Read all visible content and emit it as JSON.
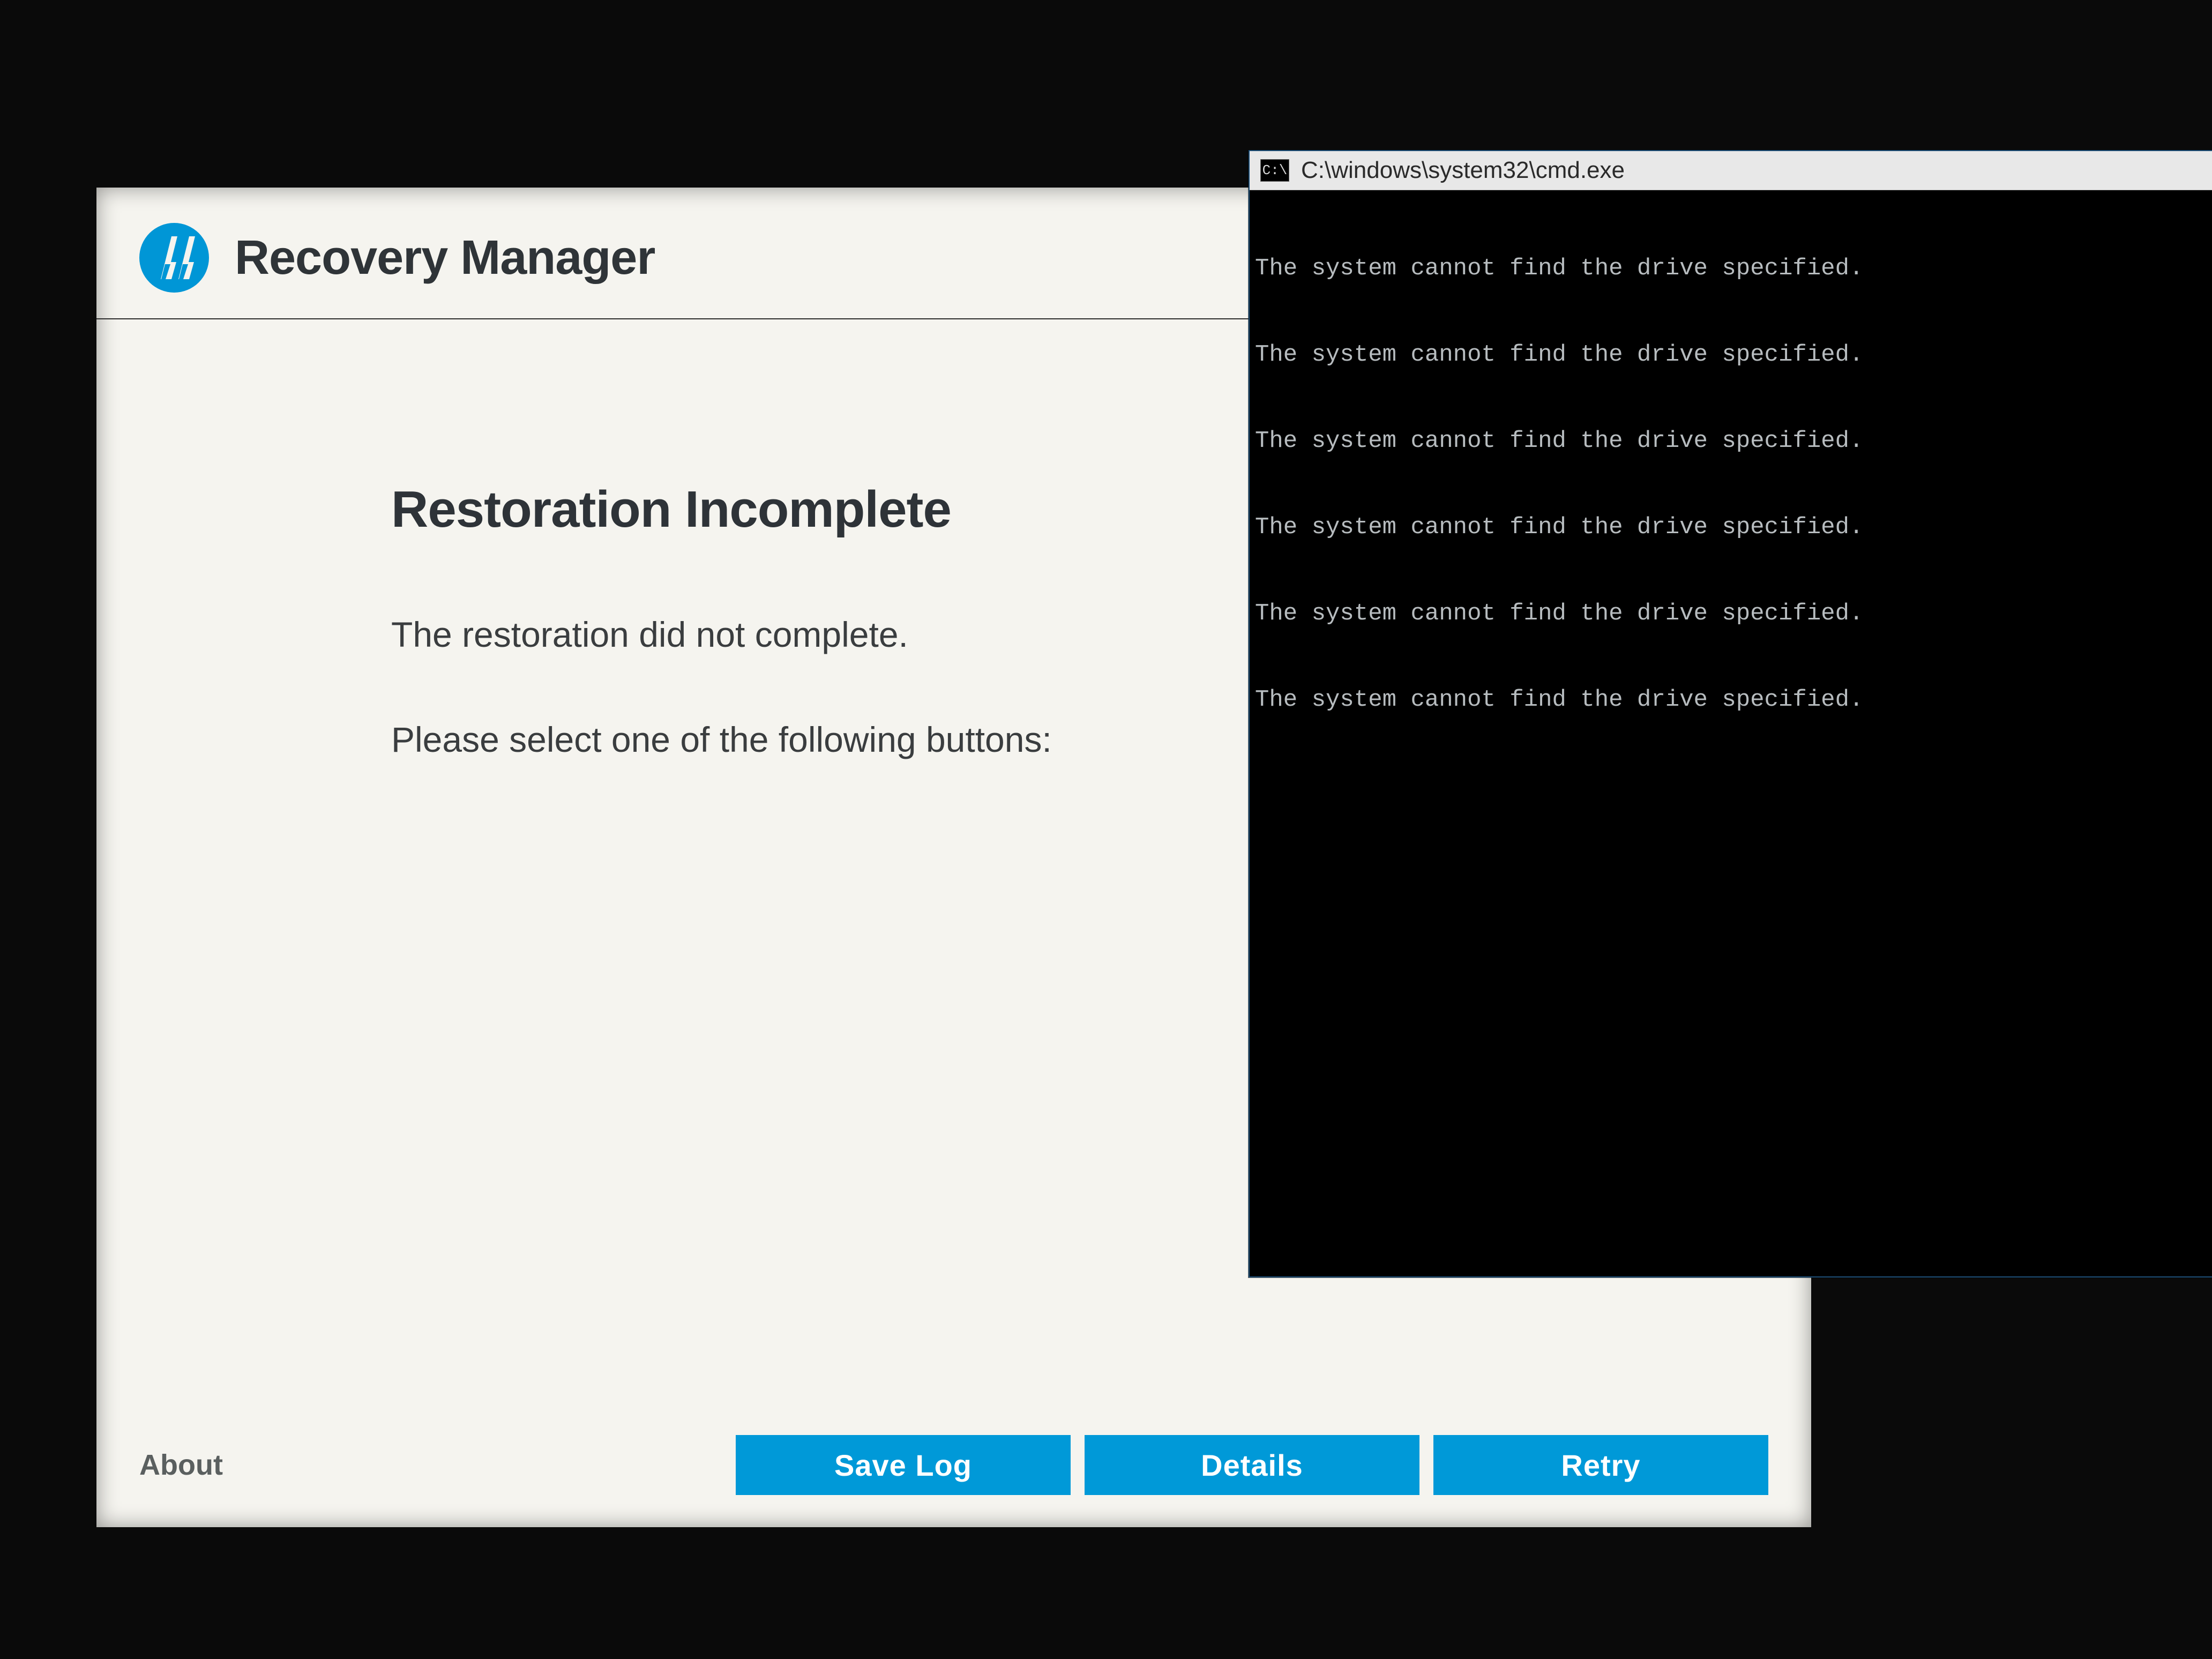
{
  "recovery": {
    "app_title": "Recovery Manager",
    "heading": "Restoration Incomplete",
    "message_line1": "The restoration did not complete.",
    "message_line2": "Please select one of the following buttons:",
    "about_label": "About",
    "buttons": {
      "save_log": "Save Log",
      "details": "Details",
      "retry": "Retry"
    }
  },
  "cmd": {
    "title": "C:\\windows\\system32\\cmd.exe",
    "icon_text": "C:\\",
    "lines": [
      "The system cannot find the drive specified.",
      "The system cannot find the drive specified.",
      "The system cannot find the drive specified.",
      "The system cannot find the drive specified.",
      "The system cannot find the drive specified.",
      "The system cannot find the drive specified."
    ]
  }
}
